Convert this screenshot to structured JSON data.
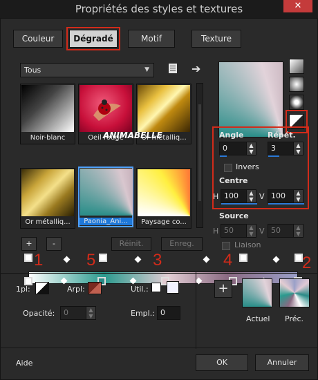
{
  "title": "Propriétés des styles et textures",
  "close_symbol": "✕",
  "tabs": [
    {
      "label": "Couleur"
    },
    {
      "label": "Dégradé"
    },
    {
      "label": "Motif"
    },
    {
      "label": "Texture"
    }
  ],
  "category_select": "Tous",
  "thumbnails": [
    {
      "label": "Noir-blanc"
    },
    {
      "label": "Oeil rouge"
    },
    {
      "label": "Or métalliq..."
    },
    {
      "label": "Or métalliq..."
    },
    {
      "label": "Paonia_Ani..."
    },
    {
      "label": "Paysage co..."
    }
  ],
  "watermark_text": "ANIMABELLE",
  "buttons": {
    "add": "+",
    "remove": "-",
    "reinit": "Réinit.",
    "enreg": "Enreg.",
    "aide": "Aide",
    "ok": "OK",
    "annuler": "Annuler",
    "big_add": "+"
  },
  "annotations": [
    "1",
    "5",
    "3",
    "4",
    "2"
  ],
  "params": {
    "angle_label": "Angle",
    "angle_value": "0",
    "repet_label": "Répét.",
    "repet_value": "3",
    "invers_label": "Invers",
    "centre_label": "Centre",
    "centre_h_label": "H",
    "centre_h_value": "100",
    "centre_v_label": "V",
    "centre_v_value": "100",
    "source_label": "Source",
    "source_h_label": "H",
    "source_h_value": "50",
    "source_v_label": "V",
    "source_v_value": "50",
    "liaison_label": "Liaison"
  },
  "bottom": {
    "pl_label": "1pl:",
    "arpl_label": "Arpl:",
    "util_label": "Util.:",
    "opacite_label": "Opacité:",
    "opacite_value": "0",
    "empl_label": "Empl.:",
    "empl_value": "0",
    "actuel_label": "Actuel",
    "prec_label": "Préc."
  },
  "colors": {
    "highlight_red": "#d22b1a",
    "selection_blue": "#1e78d9"
  }
}
